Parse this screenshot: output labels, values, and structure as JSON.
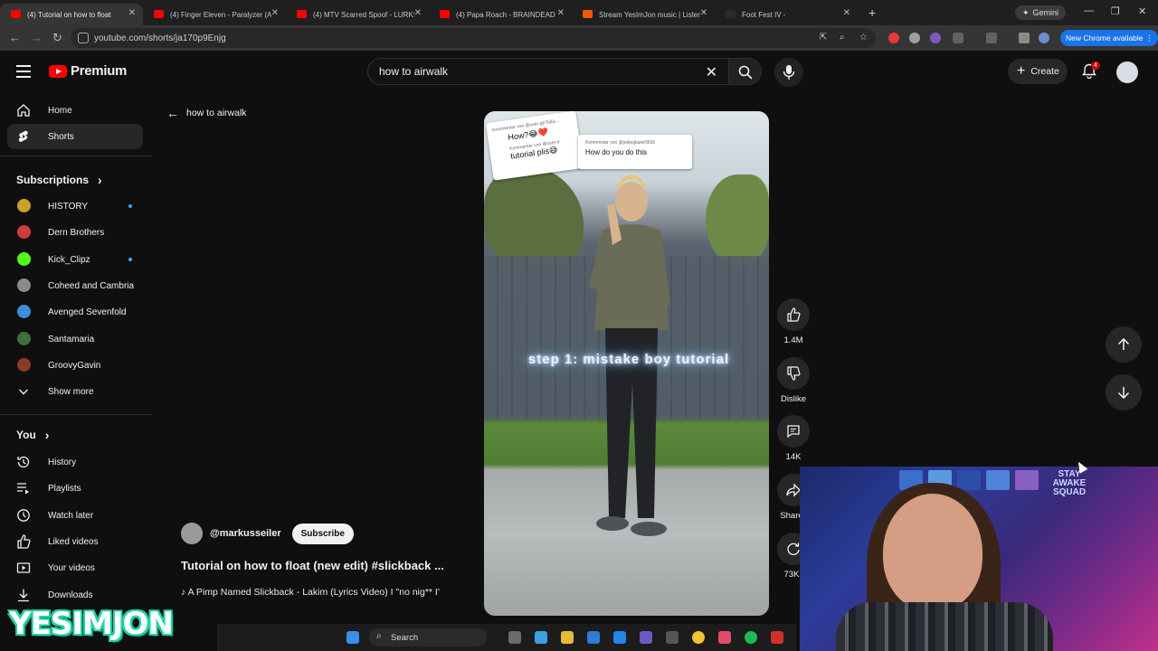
{
  "browser": {
    "tabs": [
      {
        "title": "(4) Tutorial on how to float",
        "favicon_color": "#ff0000",
        "active": true
      },
      {
        "title": "(4) Finger Eleven - Paralyzer (A",
        "favicon_color": "#ff0000",
        "active": false
      },
      {
        "title": "(4) MTV Scarred Spoof - LURKS",
        "favicon_color": "#ff0000",
        "active": false
      },
      {
        "title": "(4) Papa Roach - BRAINDEAD (",
        "favicon_color": "#ff0000",
        "active": false
      },
      {
        "title": "Stream YesImJon music | Listen",
        "favicon_color": "#ff5500",
        "active": false
      },
      {
        "title": "Foot Fest IV -",
        "favicon_color": "#2b2b2b",
        "active": false
      }
    ],
    "gemini_label": "Gemini",
    "url": "youtube.com/shorts/ja170p9Enjg",
    "new_chrome_label": "New Chrome available"
  },
  "header": {
    "brand": "Premium",
    "search_value": "how to airwalk",
    "create_label": "Create",
    "notification_count": "4"
  },
  "sidebar": {
    "main": [
      {
        "label": "Home",
        "icon": "home-icon",
        "selected": false
      },
      {
        "label": "Shorts",
        "icon": "shorts-icon",
        "selected": true
      }
    ],
    "subscriptions_title": "Subscriptions",
    "subscriptions": [
      {
        "label": "HISTORY",
        "color": "#c9a227",
        "dot": true
      },
      {
        "label": "Dern Brothers",
        "color": "#d23b3b",
        "dot": false
      },
      {
        "label": "Kick_Clipz",
        "color": "#53fc18",
        "dot": true
      },
      {
        "label": "Coheed and Cambria",
        "color": "#8a8a8a",
        "dot": false
      },
      {
        "label": "Avenged Sevenfold",
        "color": "#3a8fd8",
        "dot": false
      },
      {
        "label": "Santamaria",
        "color": "#3f6f3a",
        "dot": false
      },
      {
        "label": "GroovyGavin",
        "color": "#8c3a2a",
        "dot": false
      }
    ],
    "show_more": "Show more",
    "you_title": "You",
    "you_items": [
      {
        "label": "History",
        "icon": "history-icon"
      },
      {
        "label": "Playlists",
        "icon": "playlists-icon"
      },
      {
        "label": "Watch later",
        "icon": "watch-later-icon"
      },
      {
        "label": "Liked videos",
        "icon": "liked-icon"
      },
      {
        "label": "Your videos",
        "icon": "your-videos-icon"
      },
      {
        "label": "Downloads",
        "icon": "downloads-icon"
      }
    ]
  },
  "shorts": {
    "back_label": "how to airwalk",
    "comment1_meta": "Kommentar von @user-gb7bj5z...",
    "comment1_text": "How?😂❤️",
    "comment1b_meta": "Kommentar von @user-e",
    "comment1b_text": "tutorial plis😅",
    "comment2_meta": "Kommentar von @jodieglazer9636",
    "comment2_text": "How do you do this",
    "overlay_text": "step 1: mistake boy tutorial",
    "likes": "1.4M",
    "dislike_label": "Dislike",
    "comments": "14K",
    "share_label": "Share",
    "remix_count": "73K",
    "channel": "@markusseiler",
    "subscribe_label": "Subscribe",
    "title": "Tutorial on how to float (new edit) #slickback ...",
    "music": "A Pimp Named Slickback - Lakim (Lyrics Video) I \"no nig** I'"
  },
  "stream": {
    "sign_text": "STAY AWAKE SQUAD",
    "watermark": "YESIMJON"
  },
  "taskbar": {
    "search_label": "Search"
  }
}
